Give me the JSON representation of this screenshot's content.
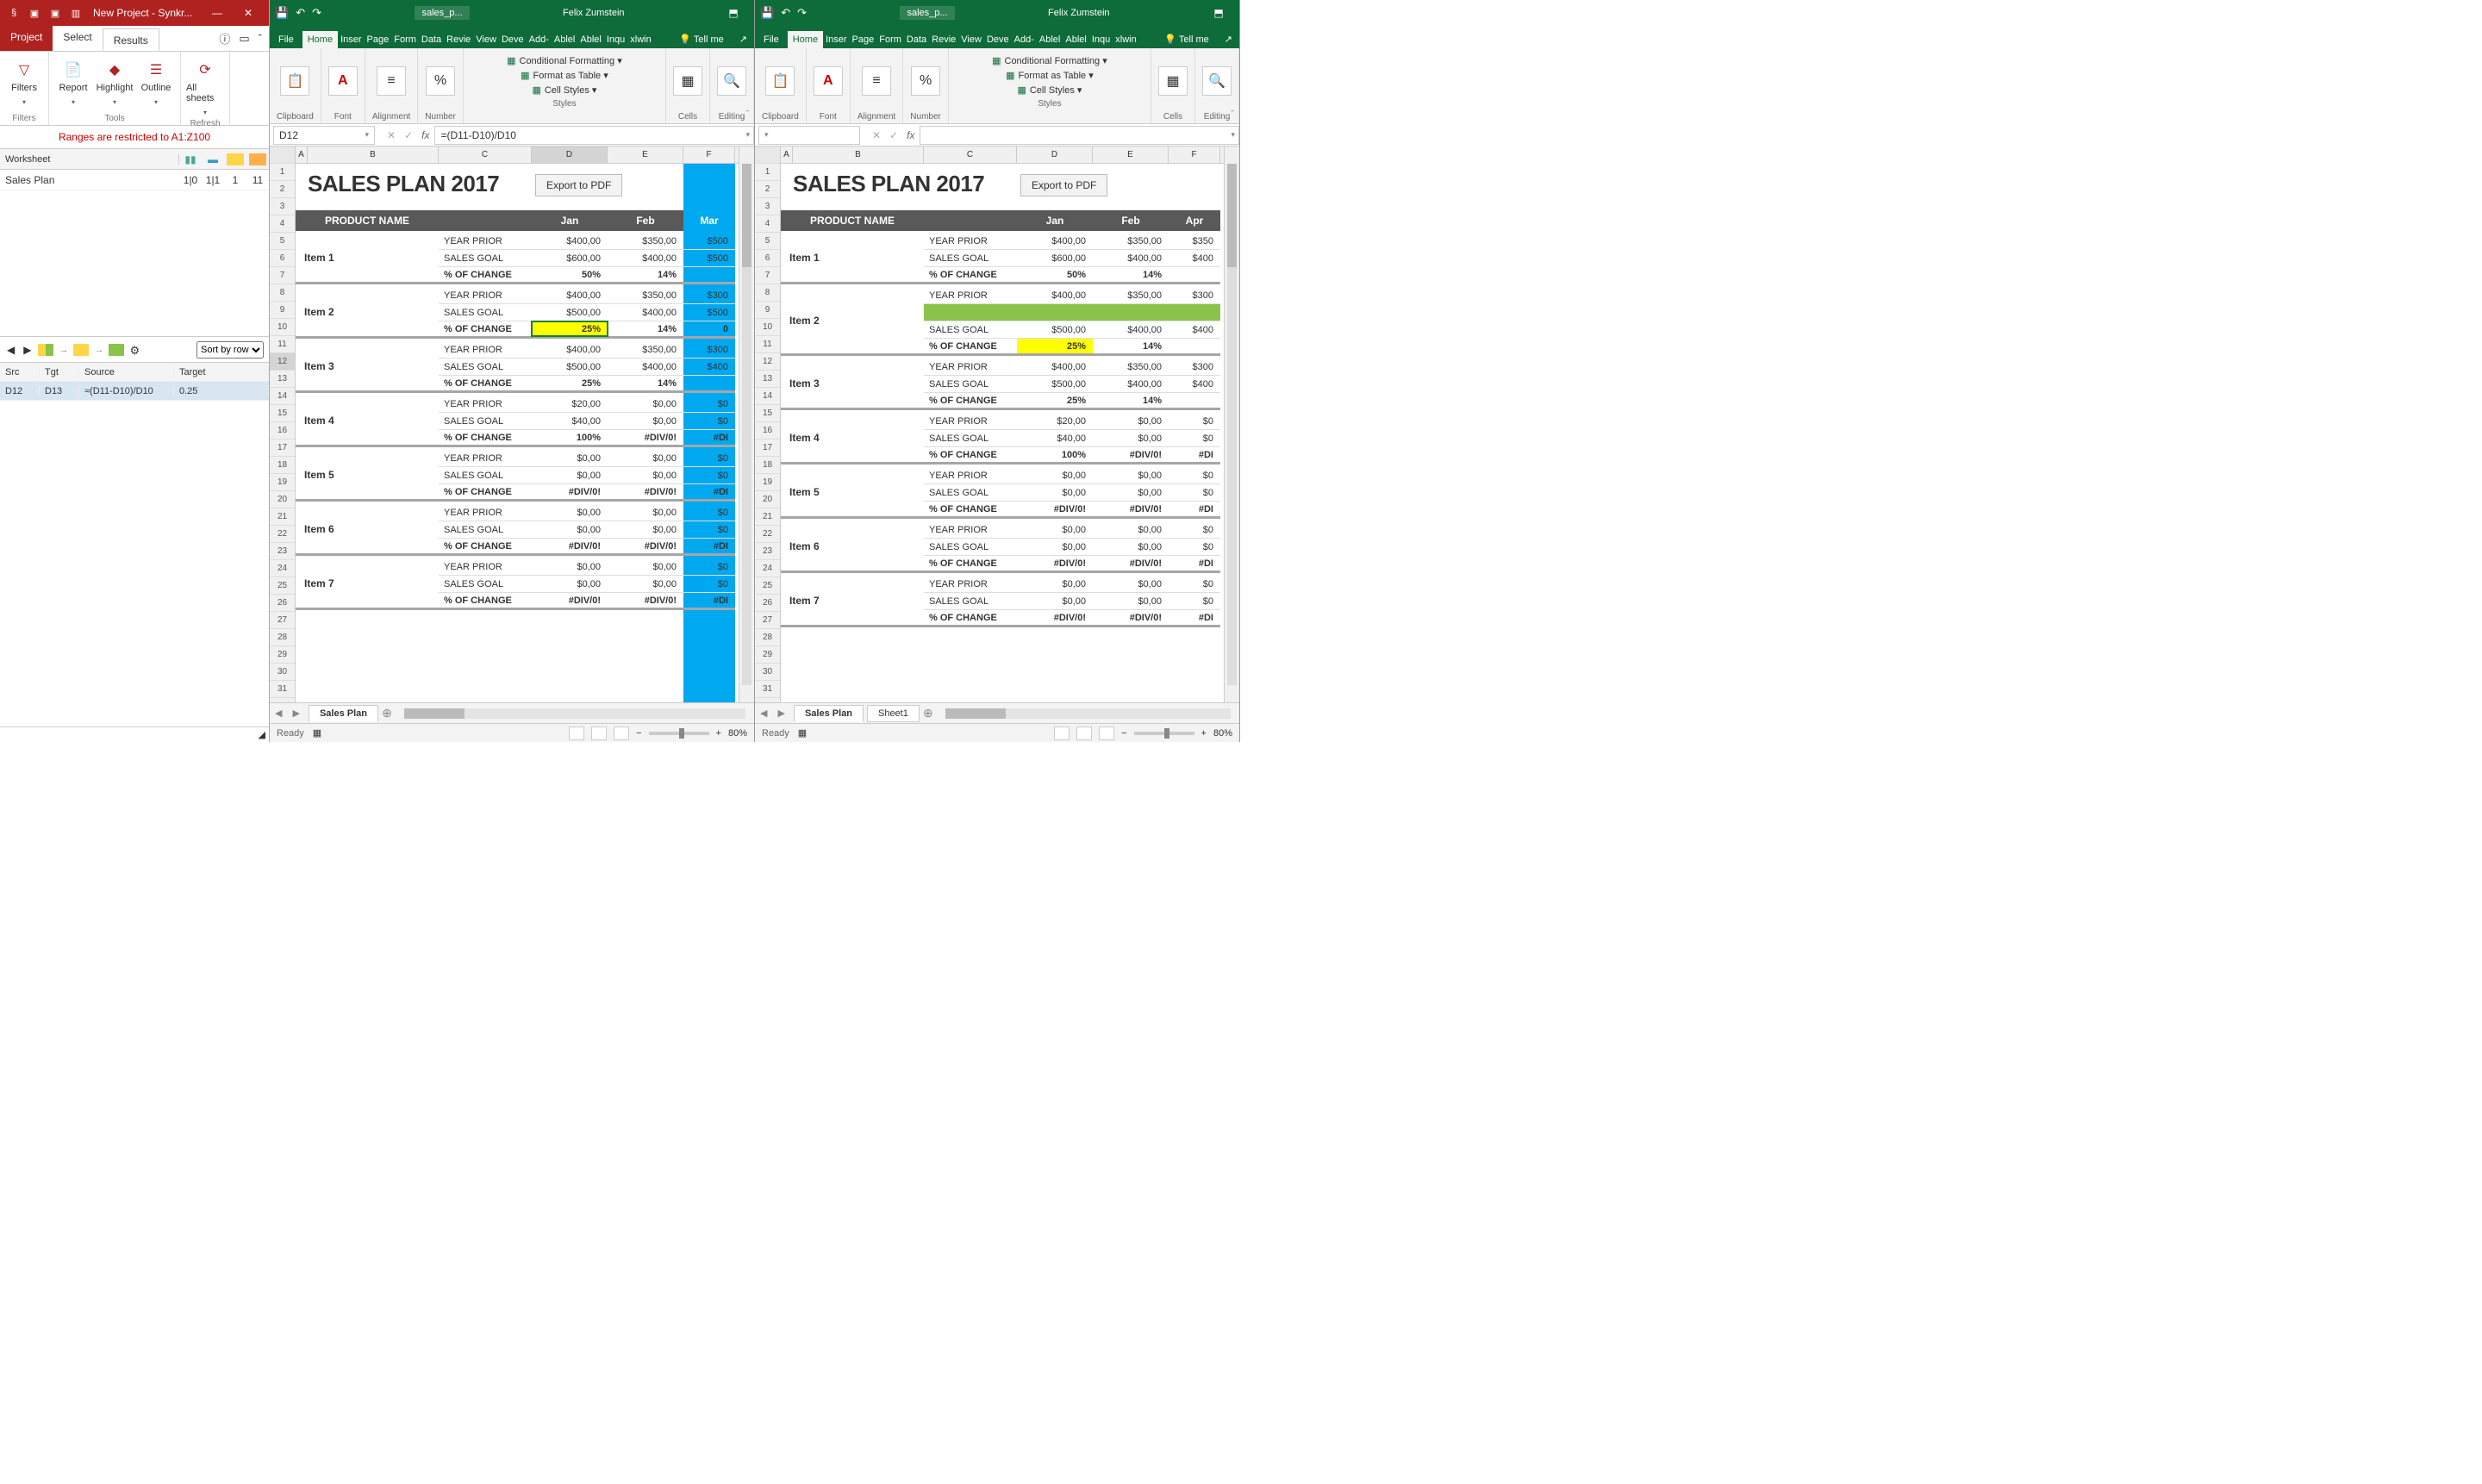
{
  "sync": {
    "title": "New Project - Synkr...",
    "tabs": {
      "project": "Project",
      "select": "Select",
      "results": "Results"
    },
    "ribbon": {
      "filters_group": "Filters",
      "filters": "Filters",
      "tools_group": "Tools",
      "report": "Report",
      "highlight": "Highlight",
      "outline": "Outline",
      "refresh_group": "Refresh",
      "allsheets": "All sheets"
    },
    "warning": "Ranges are restricted to A1:Z100",
    "worksheet_hdr": "Worksheet",
    "sheet_row": {
      "name": "Sales Plan",
      "v1": "1|0",
      "v2": "1|1",
      "v3": "1",
      "v4": "11"
    },
    "sort": "Sort by row",
    "diff": {
      "headers": {
        "src": "Src",
        "tgt": "Tgt",
        "source": "Source",
        "target": "Target"
      },
      "row": {
        "src": "D12",
        "tgt": "D13",
        "source": "≈(D11-D10)/D10",
        "target": "0.25"
      }
    }
  },
  "excel_menus": [
    "File",
    "Home",
    "Inser",
    "Page",
    "Form",
    "Data",
    "Revie",
    "View",
    "Deve",
    "Add-",
    "Ablel",
    "Ablel",
    "Inqu",
    "xlwin"
  ],
  "tellme": "Tell me",
  "xl_ribbon": {
    "clipboard": "Clipboard",
    "font": "Font",
    "alignment": "Alignment",
    "number": "Number",
    "styles": "Styles",
    "cf": "Conditional Formatting",
    "fat": "Format as Table",
    "cs": "Cell Styles",
    "cells": "Cells",
    "editing": "Editing"
  },
  "cols": [
    "A",
    "B",
    "C",
    "D",
    "E",
    "F"
  ],
  "left": {
    "doc": "sales_p...",
    "user": "Felix Zumstein",
    "cellref": "D12",
    "formula": "=(D11-D10)/D10",
    "months": [
      "Jan",
      "Feb",
      "Mar"
    ],
    "title": "SALES PLAN 2017",
    "export": "Export to PDF",
    "prodname": "PRODUCT NAME",
    "labels": {
      "yp": "YEAR PRIOR",
      "sg": "SALES GOAL",
      "pc": "% OF CHANGE"
    },
    "rows": [
      1,
      2,
      3,
      4,
      5,
      6,
      7,
      8,
      9,
      10,
      11,
      12,
      13,
      14,
      15,
      16,
      17,
      18,
      19,
      20,
      21,
      22,
      23,
      24,
      25,
      26,
      27,
      28,
      29,
      30,
      31
    ],
    "items": [
      {
        "name": "Item 1",
        "yp": [
          "$400,00",
          "$350,00",
          "$500"
        ],
        "sg": [
          "$600,00",
          "$400,00",
          "$500"
        ],
        "pc": [
          "50%",
          "14%",
          ""
        ]
      },
      {
        "name": "Item 2",
        "yp": [
          "$400,00",
          "$350,00",
          "$300"
        ],
        "sg": [
          "$500,00",
          "$400,00",
          "$500"
        ],
        "pc": [
          "25%",
          "14%",
          "0"
        ]
      },
      {
        "name": "Item 3",
        "yp": [
          "$400,00",
          "$350,00",
          "$300"
        ],
        "sg": [
          "$500,00",
          "$400,00",
          "$400"
        ],
        "pc": [
          "25%",
          "14%",
          ""
        ]
      },
      {
        "name": "Item 4",
        "yp": [
          "$20,00",
          "$0,00",
          "$0"
        ],
        "sg": [
          "$40,00",
          "$0,00",
          "$0"
        ],
        "pc": [
          "100%",
          "#DIV/0!",
          "#DI"
        ]
      },
      {
        "name": "Item 5",
        "yp": [
          "$0,00",
          "$0,00",
          "$0"
        ],
        "sg": [
          "$0,00",
          "$0,00",
          "$0"
        ],
        "pc": [
          "#DIV/0!",
          "#DIV/0!",
          "#DI"
        ]
      },
      {
        "name": "Item 6",
        "yp": [
          "$0,00",
          "$0,00",
          "$0"
        ],
        "sg": [
          "$0,00",
          "$0,00",
          "$0"
        ],
        "pc": [
          "#DIV/0!",
          "#DIV/0!",
          "#DI"
        ]
      },
      {
        "name": "Item 7",
        "yp": [
          "$0,00",
          "$0,00",
          "$0"
        ],
        "sg": [
          "$0,00",
          "$0,00",
          "$0"
        ],
        "pc": [
          "#DIV/0!",
          "#DIV/0!",
          "#DI"
        ]
      }
    ],
    "tabs": [
      "Sales Plan"
    ],
    "ready": "Ready",
    "zoom": "80%"
  },
  "right": {
    "doc": "sales_p...",
    "user": "Felix Zumstein",
    "cellref": "",
    "formula": "",
    "months": [
      "Jan",
      "Feb",
      "Apr"
    ],
    "title": "SALES PLAN 2017",
    "export": "Export to PDF",
    "prodname": "PRODUCT NAME",
    "labels": {
      "yp": "YEAR PRIOR",
      "sg": "SALES GOAL",
      "pc": "% OF CHANGE"
    },
    "rows": [
      1,
      2,
      3,
      4,
      5,
      6,
      7,
      8,
      9,
      10,
      11,
      12,
      13,
      14,
      15,
      16,
      17,
      18,
      19,
      20,
      21,
      22,
      23,
      24,
      25,
      26,
      27,
      28,
      29,
      30,
      31
    ],
    "items": [
      {
        "name": "Item 1",
        "yp": [
          "$400,00",
          "$350,00",
          "$350"
        ],
        "sg": [
          "$600,00",
          "$400,00",
          "$400"
        ],
        "pc": [
          "50%",
          "14%",
          ""
        ]
      },
      {
        "name": "Item 2",
        "yp": [
          "$400,00",
          "$350,00",
          "$300"
        ],
        "green": true,
        "sg": [
          "$500,00",
          "$400,00",
          "$400"
        ],
        "pc": [
          "25%",
          "14%",
          ""
        ]
      },
      {
        "name": "Item 3",
        "yp": [
          "$400,00",
          "$350,00",
          "$300"
        ],
        "sg": [
          "$500,00",
          "$400,00",
          "$400"
        ],
        "pc": [
          "25%",
          "14%",
          ""
        ]
      },
      {
        "name": "Item 4",
        "yp": [
          "$20,00",
          "$0,00",
          "$0"
        ],
        "sg": [
          "$40,00",
          "$0,00",
          "$0"
        ],
        "pc": [
          "100%",
          "#DIV/0!",
          "#DI"
        ]
      },
      {
        "name": "Item 5",
        "yp": [
          "$0,00",
          "$0,00",
          "$0"
        ],
        "sg": [
          "$0,00",
          "$0,00",
          "$0"
        ],
        "pc": [
          "#DIV/0!",
          "#DIV/0!",
          "#DI"
        ]
      },
      {
        "name": "Item 6",
        "yp": [
          "$0,00",
          "$0,00",
          "$0"
        ],
        "sg": [
          "$0,00",
          "$0,00",
          "$0"
        ],
        "pc": [
          "#DIV/0!",
          "#DIV/0!",
          "#DI"
        ]
      },
      {
        "name": "Item 7",
        "yp": [
          "$0,00",
          "$0,00",
          "$0"
        ],
        "sg": [
          "$0,00",
          "$0,00",
          "$0"
        ],
        "pc": [
          "#DIV/0!",
          "#DIV/0!",
          "#DI"
        ]
      }
    ],
    "tabs": [
      "Sales Plan",
      "Sheet1"
    ],
    "ready": "Ready",
    "zoom": "80%"
  }
}
